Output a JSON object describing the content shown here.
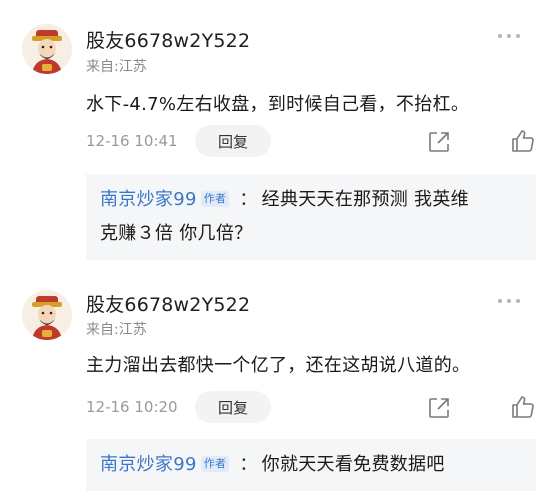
{
  "comments": [
    {
      "username": "股友6678w2Y522",
      "location": "来自:江苏",
      "content": "水下-4.7%左右收盘，到时候自己看，不抬杠。",
      "time": "12-16 10:41",
      "reply_label": "回复",
      "reply": {
        "author": "南京炒家99",
        "badge": "作者",
        "colon": "：",
        "line1": "经典天天在那预测 我英维",
        "line2": "克赚３倍 你几倍？"
      }
    },
    {
      "username": "股友6678w2Y522",
      "location": "来自:江苏",
      "content": "主力溜出去都快一个亿了，还在这胡说八道的。",
      "time": "12-16 10:20",
      "reply_label": "回复",
      "reply": {
        "author": "南京炒家99",
        "badge": "作者",
        "colon": "：",
        "line1": "你就天天看免费数据吧"
      }
    }
  ],
  "icons": {
    "avatar": "fortune-god-avatar-icon",
    "more": "more-dots-icon",
    "share": "share-icon",
    "like": "thumbs-up-icon"
  },
  "colors": {
    "reply_author": "#3a77c9",
    "reply_bg": "#f5f6f7"
  }
}
